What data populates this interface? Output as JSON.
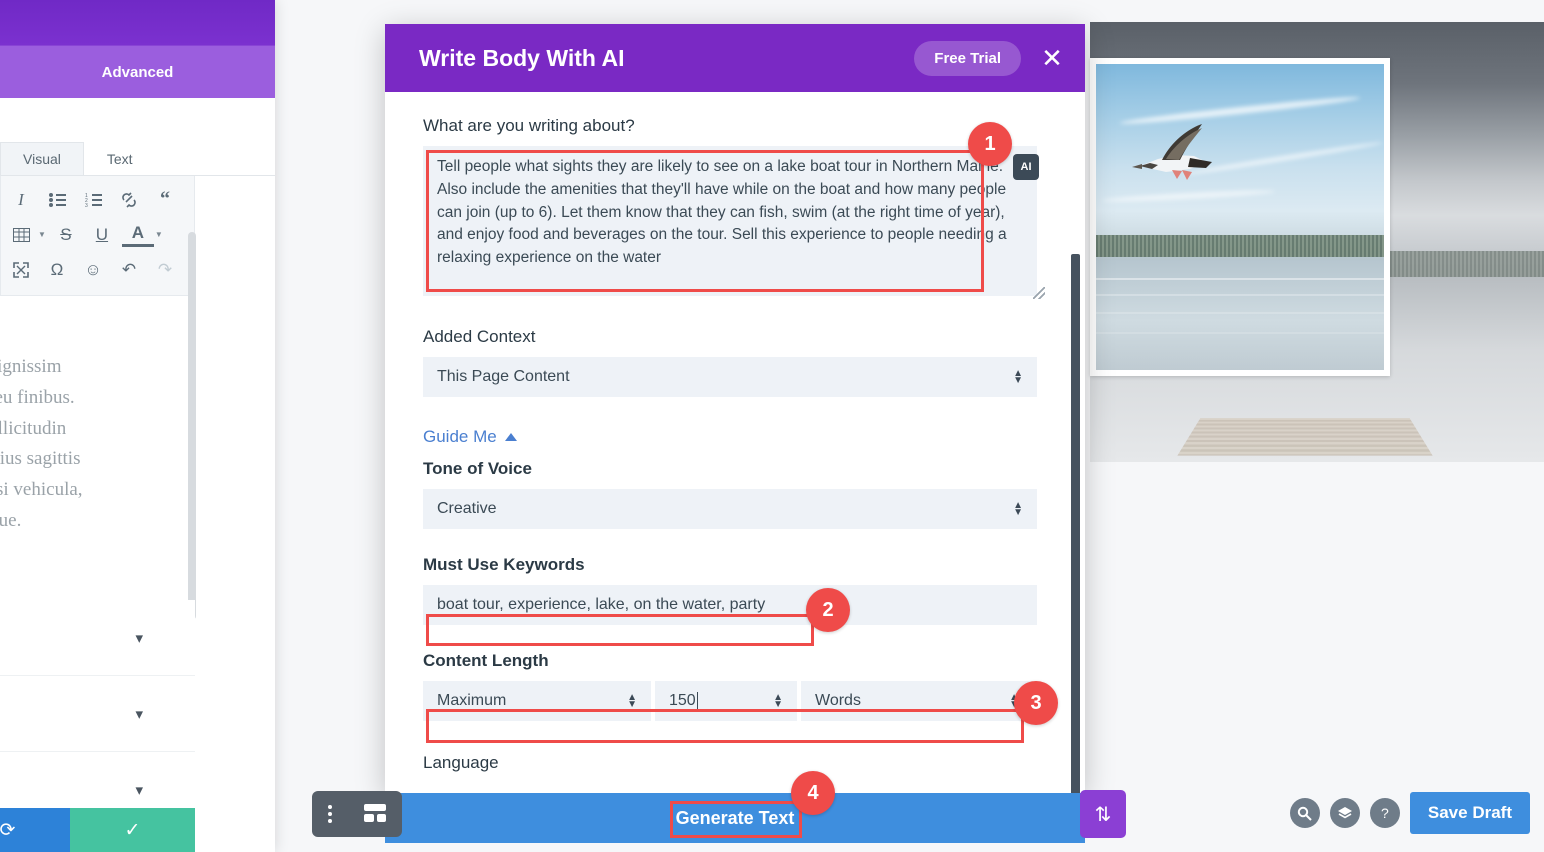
{
  "builder_panel": {
    "active_tab": "Advanced",
    "editor_tabs": [
      {
        "label": "Visual",
        "active": true
      },
      {
        "label": "Text",
        "active": false
      }
    ],
    "toolbar_rows": [
      [
        {
          "icon": "italic-icon",
          "glyph": "I"
        },
        {
          "icon": "bullet-list-icon",
          "glyph": "☰"
        },
        {
          "icon": "numbered-list-icon",
          "glyph": "☰"
        },
        {
          "icon": "link-icon",
          "glyph": "🔗"
        },
        {
          "icon": "blockquote-icon",
          "glyph": "“"
        }
      ],
      [
        {
          "icon": "table-icon",
          "glyph": "⌸"
        },
        {
          "icon": "strikethrough-icon",
          "glyph": "S"
        },
        {
          "icon": "underline-icon",
          "glyph": "U"
        },
        {
          "icon": "text-color-icon",
          "glyph": "A"
        }
      ],
      [
        {
          "icon": "fullscreen-icon",
          "glyph": "⤡"
        },
        {
          "icon": "special-character-icon",
          "glyph": "Ω"
        },
        {
          "icon": "emoji-icon",
          "glyph": "☺"
        },
        {
          "icon": "undo-icon",
          "glyph": "↶"
        },
        {
          "icon": "redo-icon",
          "glyph": "↷"
        }
      ]
    ],
    "lorem_lines": [
      "t nunc, nec dignissim",
      "s eget tellus eu finibus.",
      "e suscipit, sollicitudin",
      "rat. Nunc varius sagittis",
      "Aenean et nisi vehicula,",
      "ccumsan neque."
    ],
    "footer": {
      "redo_icon": "redo-icon",
      "save_icon": "checkmark-icon"
    }
  },
  "modal": {
    "title": "Write Body With AI",
    "free_trial_label": "Free Trial",
    "close_icon": "close-icon",
    "prompt": {
      "label": "What are you writing about?",
      "value": "Tell people what sights they are likely to see on a lake boat tour in Northern Maine. Also include the amenities that they'll have while on the boat and how many people can join (up to 6). Let them know that they can fish, swim (at the right time of year), and enjoy food and beverages on the tour. Sell this experience to people needing a relaxing experience on the water",
      "ai_chip_label": "AI"
    },
    "added_context": {
      "label": "Added Context",
      "value": "This Page Content"
    },
    "guide_me": {
      "label": "Guide Me",
      "icon": "triangle-up-icon"
    },
    "tone_of_voice": {
      "label": "Tone of Voice",
      "value": "Creative"
    },
    "must_use_keywords": {
      "label": "Must Use Keywords",
      "value": "boat tour, experience, lake, on the water, party"
    },
    "content_length": {
      "label": "Content Length",
      "mode": "Maximum",
      "amount": "150",
      "unit": "Words"
    },
    "language": {
      "label": "Language"
    },
    "generate_button": "Generate Text"
  },
  "bottom_bar": {
    "menu_icon": "three-dots-vertical-icon",
    "wireframe_icon": "wireframe-icon",
    "sort_icon": "sort-updown-icon"
  },
  "right_actions": {
    "search_icon": "search-icon",
    "layers_icon": "layers-icon",
    "help_icon": "help-icon",
    "save_draft_label": "Save Draft"
  },
  "annotations": [
    {
      "number": "1"
    },
    {
      "number": "2"
    },
    {
      "number": "3"
    },
    {
      "number": "4"
    }
  ],
  "colors": {
    "modal_header_purple": "#7a29c4",
    "annotation_red": "#ef4b49",
    "primary_blue": "#3e8ede",
    "panel_purple": "#9b5ede",
    "field_bg": "#eef2f7",
    "accent_green": "#45c3a0"
  }
}
